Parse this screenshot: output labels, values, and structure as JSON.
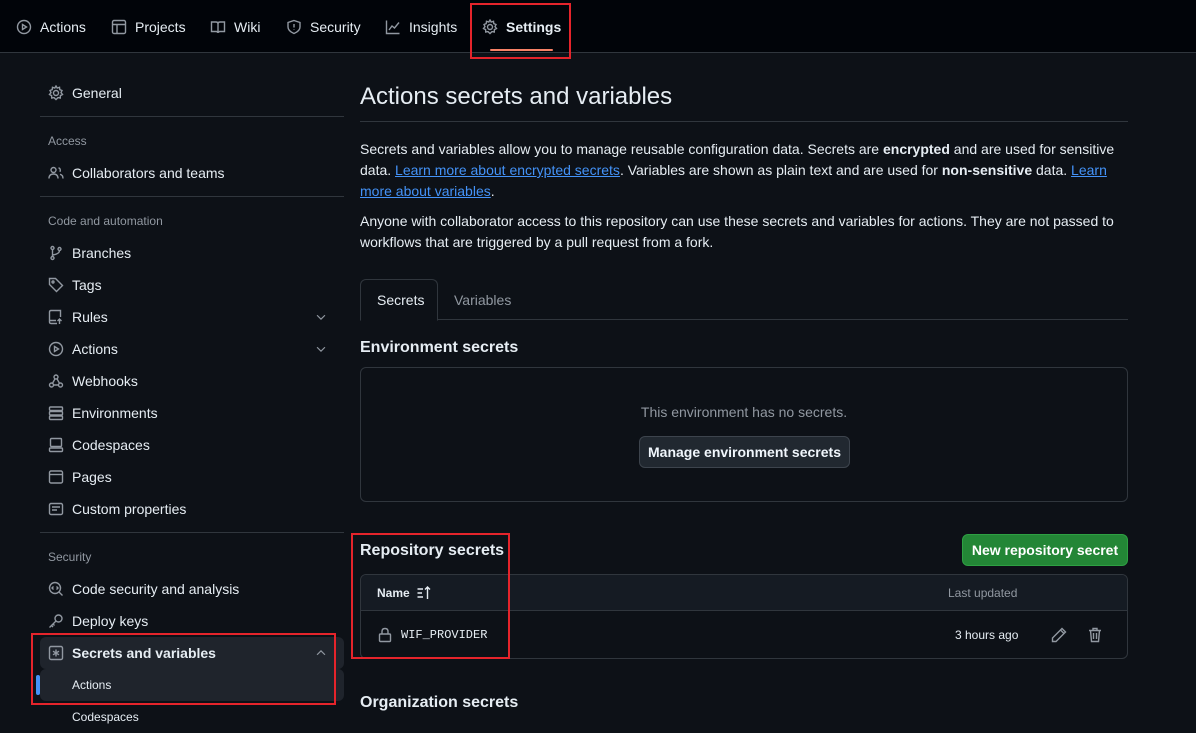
{
  "topnav": {
    "tabs": [
      {
        "label": "Actions",
        "icon": "play-icon"
      },
      {
        "label": "Projects",
        "icon": "table-icon"
      },
      {
        "label": "Wiki",
        "icon": "book-icon"
      },
      {
        "label": "Security",
        "icon": "shield-icon"
      },
      {
        "label": "Insights",
        "icon": "graph-icon"
      },
      {
        "label": "Settings",
        "icon": "gear-icon",
        "active": true
      }
    ]
  },
  "sidebar": {
    "general": "General",
    "access_heading": "Access",
    "access_items": [
      "Collaborators and teams"
    ],
    "code_heading": "Code and automation",
    "code_items": [
      "Branches",
      "Tags",
      "Rules",
      "Actions",
      "Webhooks",
      "Environments",
      "Codespaces",
      "Pages",
      "Custom properties"
    ],
    "security_heading": "Security",
    "security_items": [
      "Code security and analysis",
      "Deploy keys",
      "Secrets and variables"
    ],
    "sub_items": [
      "Actions",
      "Codespaces"
    ]
  },
  "main": {
    "title": "Actions secrets and variables",
    "intro_1": "Secrets and variables allow you to manage reusable configuration data. Secrets are ",
    "intro_encrypted": "encrypted",
    "intro_2": " and are used for sensitive data. ",
    "link_secrets": "Learn more about encrypted secrets",
    "intro_3": ". Variables are shown as plain text and are used for ",
    "intro_nonsensitive": "non-sensitive",
    "intro_4": " data. ",
    "link_variables": "Learn more about variables",
    "intro_5": ".",
    "access_note": "Anyone with collaborator access to this repository can use these secrets and variables for actions. They are not passed to workflows that are triggered by a pull request from a fork.",
    "tabs": [
      "Secrets",
      "Variables"
    ],
    "env_title": "Environment secrets",
    "env_empty": "This environment has no secrets.",
    "env_button": "Manage environment secrets",
    "repo_title": "Repository secrets",
    "new_secret_button": "New repository secret",
    "table": {
      "col_name": "Name",
      "col_updated": "Last updated",
      "rows": [
        {
          "name": "WIF_PROVIDER",
          "updated": "3 hours ago"
        }
      ]
    },
    "org_title": "Organization secrets"
  },
  "colors": {
    "accent_link": "#4493f8",
    "primary_button": "#238636",
    "highlight": "#e5242b"
  }
}
